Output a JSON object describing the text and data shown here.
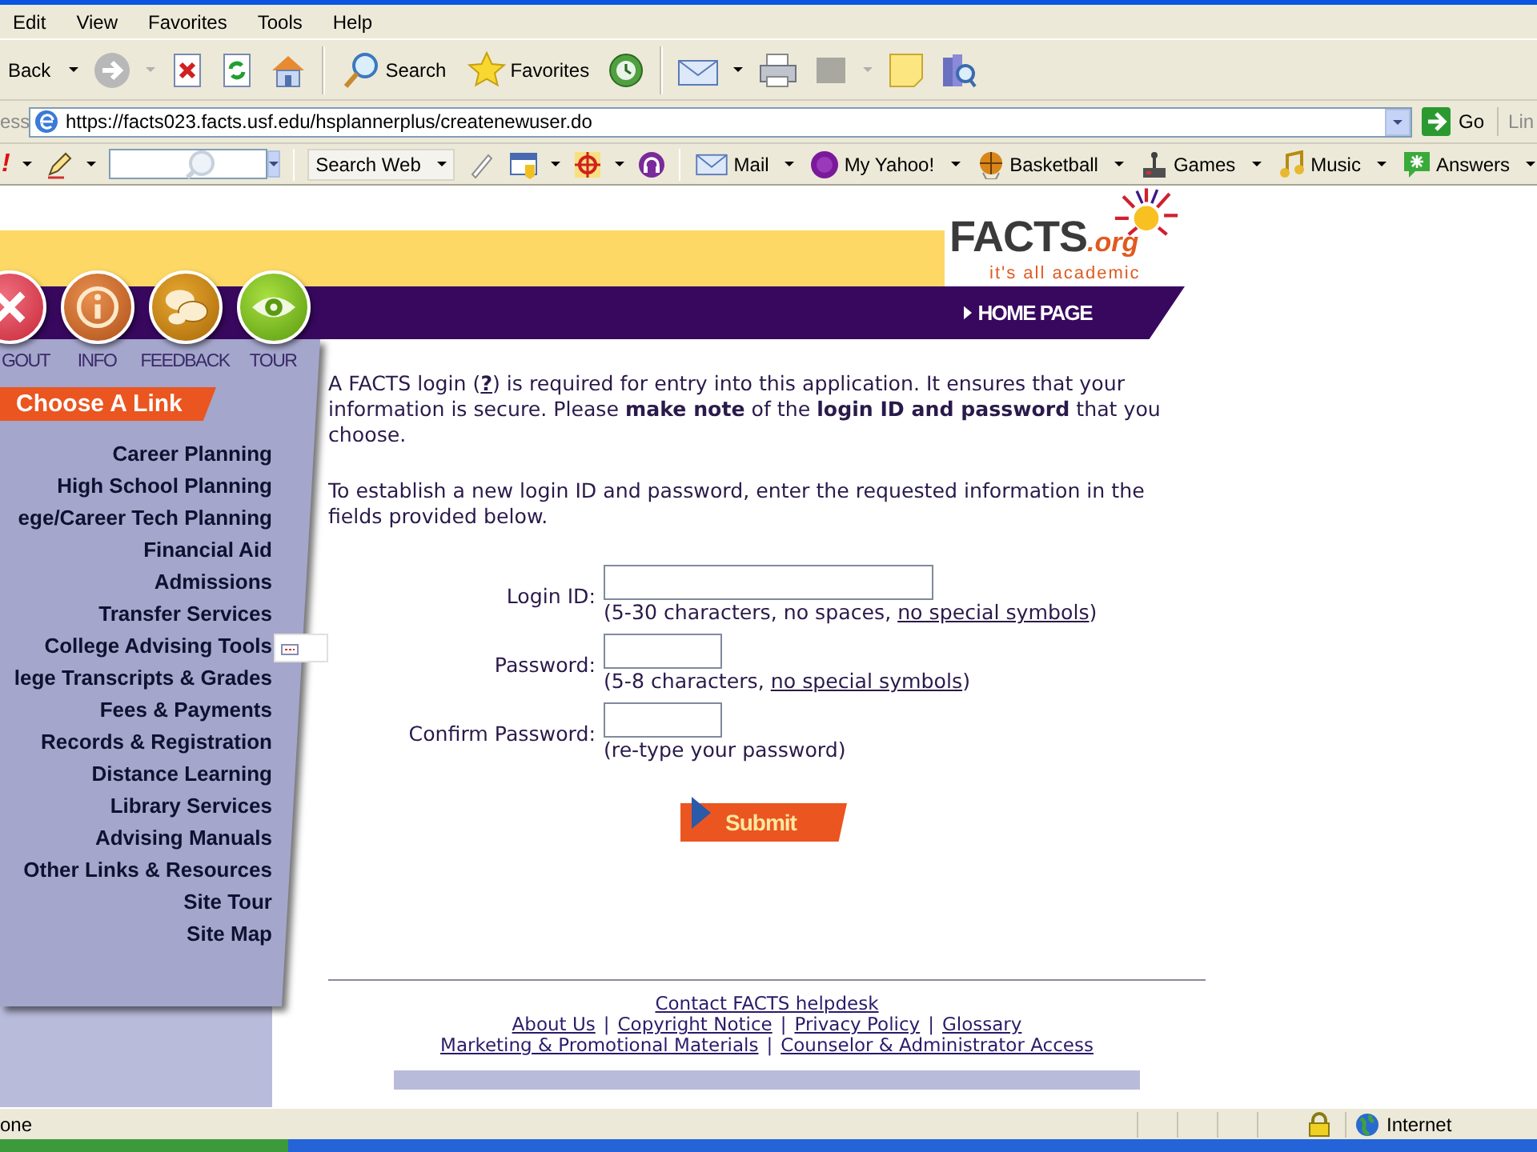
{
  "menu_bar": [
    "Edit",
    "View",
    "Favorites",
    "Tools",
    "Help"
  ],
  "toolbar": {
    "back": "Back",
    "search": "Search",
    "favorites": "Favorites"
  },
  "address_bar": {
    "label": "ess",
    "url": "https://facts023.facts.usf.edu/hsplannerplus/createnewuser.do",
    "go": "Go",
    "links": "Lin"
  },
  "yahoo_toolbar": {
    "logo": "!",
    "search_button": "Search Web",
    "items": [
      {
        "label": "Mail",
        "kind": "mail"
      },
      {
        "label": "My Yahoo!",
        "kind": "circle"
      },
      {
        "label": "Basketball",
        "kind": "ball"
      },
      {
        "label": "Games",
        "kind": "joystick"
      },
      {
        "label": "Music",
        "kind": "note"
      },
      {
        "label": "Answers",
        "kind": "answers"
      }
    ]
  },
  "site": {
    "logo": {
      "name": "FACTS",
      "suffix": ".org",
      "tagline": "it's all academic"
    },
    "home_link": "HOME PAGE",
    "nav_buttons": [
      {
        "label": "GOUT",
        "kind": "close"
      },
      {
        "label": "INFO",
        "kind": "info"
      },
      {
        "label": "FEEDBACK",
        "kind": "chat"
      },
      {
        "label": "TOUR",
        "kind": "eye"
      }
    ],
    "choose_link": "Choose A Link",
    "sidebar_links": [
      "Career Planning",
      "High School Planning",
      "ege/Career Tech Planning",
      "Financial Aid",
      "Admissions",
      "Transfer Services",
      "College Advising Tools",
      "lege Transcripts & Grades",
      "Fees & Payments",
      "Records & Registration",
      "Distance Learning",
      "Library Services",
      "Advising Manuals",
      "Other Links & Resources",
      "Site Tour",
      "Site Map"
    ],
    "intro": {
      "before": "A FACTS login (",
      "help_link": "?",
      "after": ") is required for entry into this application. It ensures that your information is secure. Please **make note** of the **login ID and password** that you choose."
    },
    "instructions": "To establish a new login ID and password, enter the requested information in the fields provided below.",
    "fields": [
      {
        "label": "Login ID:",
        "kind": "text",
        "hint_before": "(5-30 characters, no spaces, ",
        "hint_link": "no special symbols",
        "hint_after": ")"
      },
      {
        "label": "Password:",
        "kind": "password",
        "hint_before": "(5-8 characters, ",
        "hint_link": "no special symbols",
        "hint_after": ")"
      },
      {
        "label": "Confirm Password:",
        "kind": "password",
        "hint_before": "(re-type your password)"
      }
    ],
    "submit": "Submit",
    "footer_lines": [
      {
        "links": [
          "Contact FACTS helpdesk"
        ]
      },
      {
        "links": [
          "About Us",
          "Copyright Notice",
          "Privacy Policy",
          "Glossary"
        ]
      },
      {
        "links": [
          "Marketing & Promotional Materials",
          "Counselor & Administrator Access"
        ]
      }
    ],
    "footer_separator": "|"
  },
  "status_bar": {
    "text": "one",
    "zone": "Internet"
  }
}
